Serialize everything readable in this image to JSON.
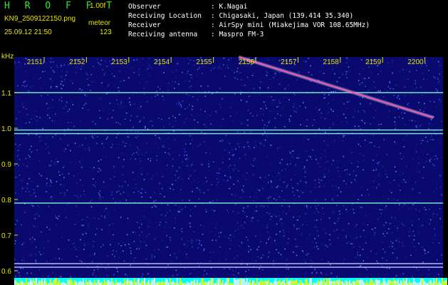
{
  "header": {
    "app_name": "H R O F F T",
    "version": "1.00f",
    "file_name": "KN9_2509122150.png",
    "mode": "meteor",
    "date_time": "25.09.12 21:50",
    "count": "123",
    "fields": [
      {
        "key": "Observer",
        "value": ": K.Nagai"
      },
      {
        "key": "Receiving Location",
        "value": ": Chigasaki, Japan (139.414 35.340)"
      },
      {
        "key": "Receiver",
        "value": ": AirSpy mini (Miakejima VOR 108.65MHz)"
      },
      {
        "key": "Receiving antenna",
        "value": ": Maspro FM-3"
      }
    ]
  },
  "colors": {
    "background": "#0a0a6e",
    "label": "#e6e600",
    "title": "#2ee62e",
    "carrier": "#7fffd4",
    "meteor_trail": "#ff5a9a",
    "activity_bar": "#00ffff"
  },
  "chart_data": {
    "type": "heatmap",
    "title": "",
    "ylabel": "kHz",
    "xlabel": "",
    "x_ticks": [
      "2151",
      "2152",
      "2153",
      "2154",
      "2155",
      "2156",
      "2157",
      "2158",
      "2159",
      "2200"
    ],
    "y_ticks": [
      "1.1",
      "1.0",
      "0.9",
      "0.8",
      "0.7",
      "0.6"
    ],
    "ylim": [
      0.58,
      1.2
    ],
    "horizontal_signals_khz": [
      1.1,
      0.995,
      0.985,
      0.79,
      0.62,
      0.61
    ],
    "meteor_trail": {
      "start": [
        "2155.6",
        1.2
      ],
      "end": [
        "2200.2",
        1.03
      ]
    },
    "grid": false
  }
}
